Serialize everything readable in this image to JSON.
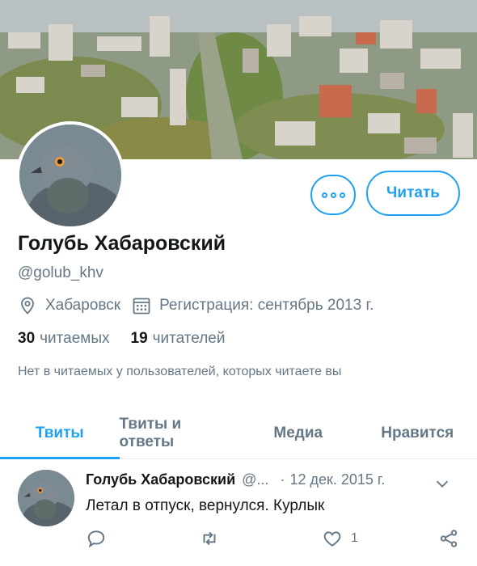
{
  "profile": {
    "name": "Голубь Хабаровский",
    "handle": "@golub_khv",
    "location": "Хабаровск",
    "joined": "Регистрация: сентябрь 2013 г.",
    "following_count": "30",
    "following_label": "читаемых",
    "followers_count": "19",
    "followers_label": "читателей",
    "known_followers": "Нет в читаемых у пользователей, которых читаете вы"
  },
  "buttons": {
    "follow_label": "Читать",
    "more_icon": "more-dots-icon"
  },
  "tabs": [
    {
      "label": "Твиты",
      "active": true
    },
    {
      "label": "Твиты и ответы",
      "active": false
    },
    {
      "label": "Медиа",
      "active": false
    },
    {
      "label": "Нравится",
      "active": false
    }
  ],
  "tweet": {
    "author": "Голубь Хабаровский",
    "handle": "@...",
    "separator": "·",
    "date": "12 дек. 2015 г.",
    "text": "Летал в отпуск, вернулся. Курлык",
    "likes": "1"
  },
  "colors": {
    "accent": "#1da1f2",
    "text": "#14171a",
    "muted": "#657786",
    "divider": "#e6ecf0"
  },
  "icons": [
    "location-icon",
    "calendar-icon",
    "reply-icon",
    "retweet-icon",
    "like-icon",
    "share-icon",
    "chevron-down-icon"
  ]
}
